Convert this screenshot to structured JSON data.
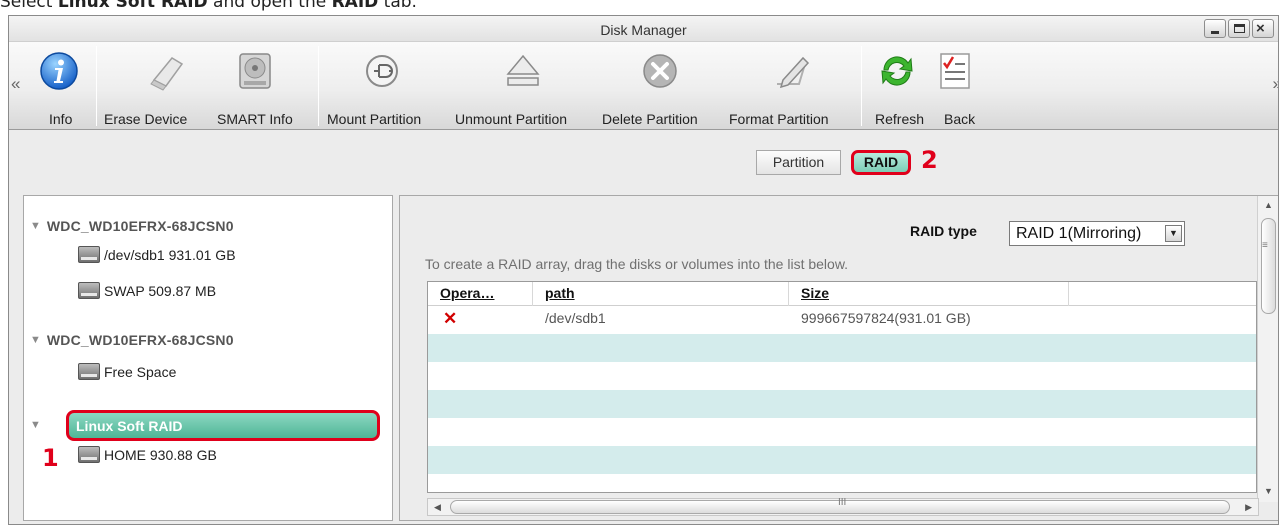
{
  "caption": {
    "prefix": "Select ",
    "item": "Linux Soft RAID",
    "middle": " and open the ",
    "tab": "RAID",
    "suffix": " tab."
  },
  "window": {
    "title": "Disk Manager"
  },
  "toolbar": {
    "items": [
      {
        "label": "Info",
        "icon": "info-icon"
      },
      {
        "label": "Erase Device",
        "icon": "eraser-icon"
      },
      {
        "label": "SMART Info",
        "icon": "hard-drive-icon"
      },
      {
        "label": "Mount Partition",
        "icon": "plug-icon"
      },
      {
        "label": "Unmount Partition",
        "icon": "eject-icon"
      },
      {
        "label": "Delete Partition",
        "icon": "delete-icon"
      },
      {
        "label": "Format Partition",
        "icon": "pencil-icon"
      },
      {
        "label": "Refresh",
        "icon": "refresh-icon"
      },
      {
        "label": "Back",
        "icon": "checklist-icon"
      }
    ],
    "nav_left": "«",
    "nav_right": "»"
  },
  "tabs": {
    "partition": "Partition",
    "raid": "RAID"
  },
  "markers": {
    "one": "1",
    "two": "2"
  },
  "tree": {
    "disk1": {
      "name": "WDC_WD10EFRX-68JCSN0",
      "children": [
        "/dev/sdb1 931.01 GB",
        "SWAP 509.87 MB"
      ]
    },
    "disk2": {
      "name": "WDC_WD10EFRX-68JCSN0",
      "children": [
        "Free Space"
      ]
    },
    "raid": {
      "name": "Linux Soft RAID",
      "children": [
        "HOME 930.88 GB"
      ]
    }
  },
  "raid": {
    "type_label": "RAID type",
    "type_value": "RAID 1(Mirroring)",
    "hint": "To create a RAID array, drag the disks or volumes into the list below.",
    "columns": [
      "Opera…",
      "path",
      "Size"
    ],
    "rows": [
      {
        "path": "/dev/sdb1",
        "size": "999667597824(931.01 GB)"
      }
    ]
  },
  "scroll": {
    "grip_h": "III",
    "grip_v": "≡"
  },
  "colors": {
    "accent_red": "#e0001b",
    "selected_teal": "#4fb596",
    "row_alt": "#d4ecec"
  }
}
